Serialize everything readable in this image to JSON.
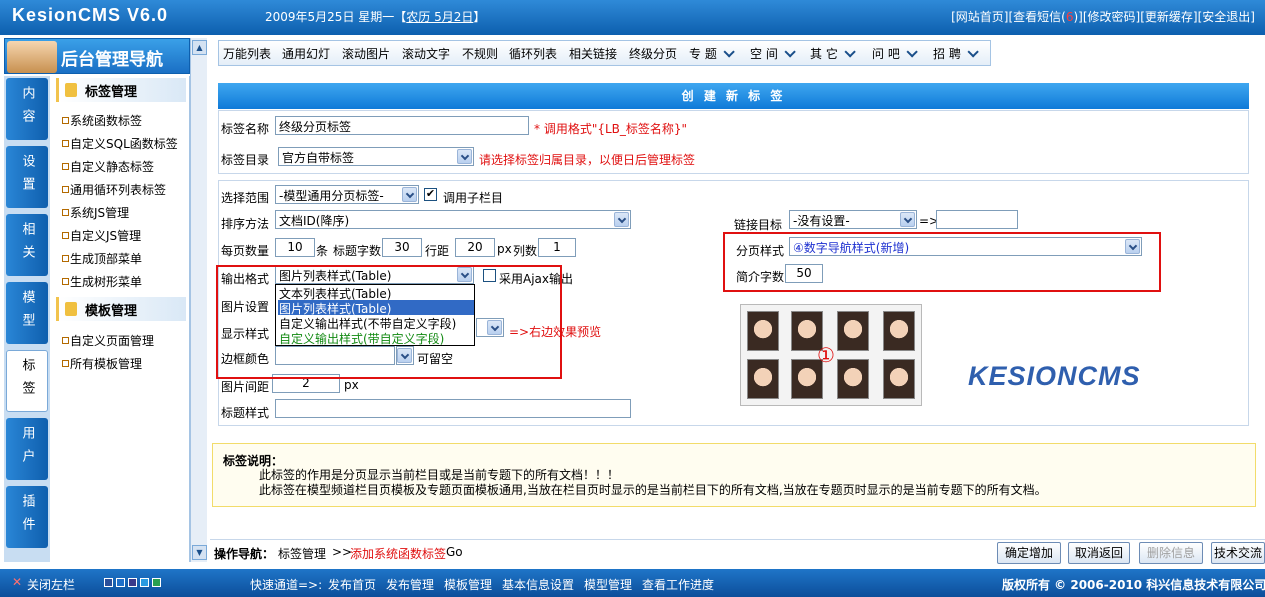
{
  "header": {
    "logo": "KesionCMS V6.0",
    "date": "2009年5月25日 星期一【",
    "lunar": "农历 5月2日",
    "date_tail": "】",
    "links": [
      "[网站首页]",
      "[查看短信(",
      "6",
      ")]",
      "[修改密码]",
      "[更新缓存]",
      "[安全退出]"
    ]
  },
  "nav": {
    "title": "后台管理导航",
    "vtabs": [
      "内容",
      "设置",
      "相关",
      "模型",
      "标签",
      "用户",
      "插件"
    ],
    "group1": "标签管理",
    "group1_items": [
      "系统函数标签",
      "自定义SQL函数标签",
      "自定义静态标签",
      "通用循环列表标签",
      "系统JS管理",
      "自定义JS管理",
      "生成顶部菜单",
      "生成树形菜单"
    ],
    "group2": "模板管理",
    "group2_items": [
      "自定义页面管理",
      "所有模板管理"
    ]
  },
  "tabs": [
    "万能列表",
    "通用幻灯",
    "滚动图片",
    "滚动文字",
    "不规则",
    "循环列表",
    "相关链接",
    "终级分页",
    "专 题",
    "空 间",
    "其 它",
    "问 吧",
    "招 聘"
  ],
  "form": {
    "caption": "创 建 新 标 签",
    "name_label": "标签名称",
    "name_value": "终级分页标签",
    "name_hint": "* 调用格式\"{LB_标签名称}\"",
    "dir_label": "标签目录",
    "dir_value": "官方自带标签",
    "dir_hint": "请选择标签归属目录，以便日后管理标签",
    "scope_label": "选择范围",
    "scope_value": "-模型通用分页标签-",
    "sub_label": "调用子栏目",
    "sort_label": "排序方法",
    "sort_value": "文档ID(降序)",
    "target_label": "链接目标",
    "target_value": "-没有设置-",
    "target_arrow": "=>",
    "perpage_label": "每页数量",
    "perpage_value": "10",
    "perpage_unit": "条",
    "titlelen_label": "标题字数",
    "titlelen_value": "30",
    "rowgap_label": "行距",
    "rowgap_value": "20",
    "rowgap_unit": "px",
    "cols_label": "列数",
    "cols_value": "1",
    "pagestyle_label": "分页样式",
    "pagestyle_value": "④数字导航样式(新增)",
    "intro_label": "简介字数",
    "intro_value": "50",
    "output_label": "输出格式",
    "output_value": "图片列表样式(Table)",
    "ajax_label": "采用Ajax输出",
    "output_options": [
      "文本列表样式(Table)",
      "图片列表样式(Table)",
      "自定义输出样式(不带自定义字段)",
      "自定义输出样式(带自定义字段)"
    ],
    "pic_label": "图片设置",
    "display_label": "显示样式",
    "preview_hint": "=>右边效果预览",
    "border_label": "边框颜色",
    "border_hint": "可留空",
    "spacing_label": "图片间距",
    "spacing_value": "2",
    "spacing_unit": "px",
    "titlestyle_label": "标题样式",
    "marker": "①",
    "brand": "KESIONCMS"
  },
  "note": {
    "title": "标签说明：",
    "line1": "此标签的作用是分页显示当前栏目或是当前专题下的所有文档！！！",
    "line2": "此标签在模型频道栏目页模板及专题页面模板通用,当放在栏目页时显示的是当前栏目下的所有文档,当放在专题页时显示的是当前专题下的所有文档。"
  },
  "opbar": {
    "label": "操作导航：",
    "path1": "标签管理",
    "sep": ">>",
    "path2": "添加系统函数标签",
    "go": "Go",
    "buttons": [
      "确定增加",
      "取消返回",
      "删除信息",
      "技术交流"
    ]
  },
  "footer": {
    "close": "关闭左栏",
    "quick": "快速通道=>:",
    "links": [
      "发布首页",
      "发布管理",
      "模板管理",
      "基本信息设置",
      "模型管理",
      "查看工作进度"
    ],
    "copyright": "版权所有 © 2006-2010 科兴信息技术有限公司",
    "swatches": [
      "#2a4f9a",
      "#1f6fc8",
      "#3a3a8a",
      "#2a9ae0",
      "#2aa050"
    ]
  },
  "colors": {
    "accent": "#0f7ad8",
    "alert": "#e01010",
    "link": "#1c2fd0"
  }
}
